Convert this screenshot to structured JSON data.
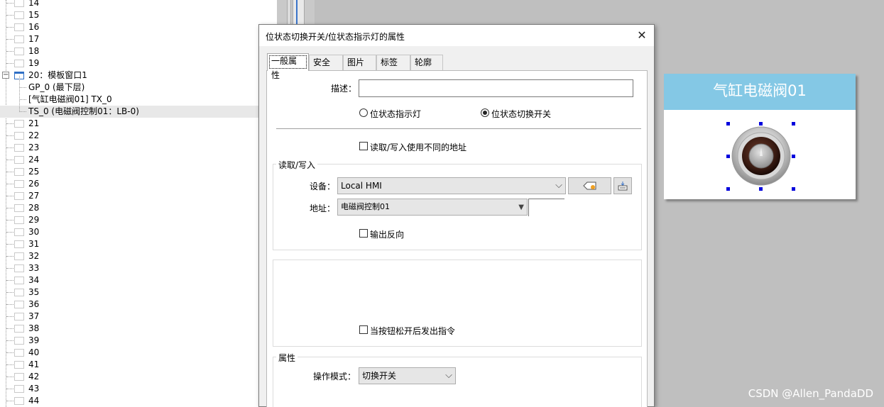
{
  "tree": {
    "top_items": [
      "14",
      "15",
      "16",
      "17",
      "18",
      "19"
    ],
    "expanded": {
      "label": "20：模板窗口1",
      "children": [
        "GP_0 (最下层)",
        "[气缸电磁阀01] TX_0",
        "TS_0 (电磁阀控制01：LB-0)"
      ]
    },
    "bottom_items": [
      "21",
      "22",
      "23",
      "24",
      "25",
      "26",
      "27",
      "28",
      "29",
      "30",
      "31",
      "32",
      "33",
      "34",
      "35",
      "36",
      "37",
      "38",
      "39",
      "40",
      "41",
      "42",
      "43",
      "44"
    ]
  },
  "dialog": {
    "title": "位状态切换开关/位状态指示灯的属性",
    "close_glyph": "✕",
    "tabs": [
      "一般属性",
      "安全",
      "图片",
      "标签",
      "轮廓"
    ],
    "active_tab": "一般属性",
    "description": {
      "label": "描述：",
      "value": ""
    },
    "mode_radios": [
      {
        "label": "位状态指示灯",
        "checked": false
      },
      {
        "label": "位状态切换开关",
        "checked": true
      }
    ],
    "diff_address": {
      "label": "读取/写入使用不同的地址",
      "checked": false
    },
    "rw_group": {
      "title": "读取/写入",
      "device_label": "设备：",
      "device_value": "Local HMI",
      "address_label": "地址：",
      "address_value": "电磁阀控制01",
      "invert_output": {
        "label": "输出反向",
        "checked": false
      }
    },
    "release_cmd": {
      "label": "当按钮松开后发出指令",
      "checked": false
    },
    "attr_group": {
      "title": "属性",
      "op_mode_label": "操作模式：",
      "op_mode_value": "切换开关"
    }
  },
  "preview": {
    "title": "气缸电磁阀01",
    "header_color": "#84c8e5"
  },
  "watermark": "CSDN @Allen_PandaDD"
}
